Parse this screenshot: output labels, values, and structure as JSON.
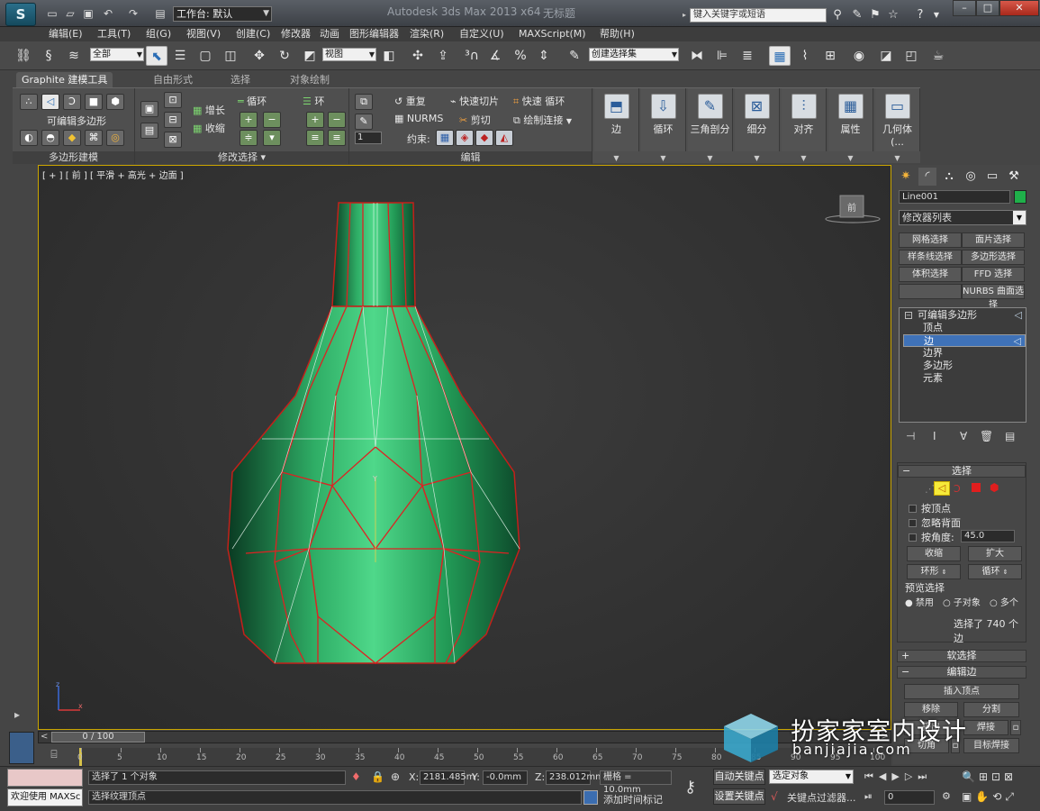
{
  "titlebar": {
    "app_title": "Autodesk 3ds Max  2013 x64",
    "doc_title": "无标题",
    "workspace_label": "工作台: 默认",
    "search_placeholder": "键入关键字或短语"
  },
  "menu": [
    "编辑(E)",
    "工具(T)",
    "组(G)",
    "视图(V)",
    "创建(C)",
    "修改器",
    "动画",
    "图形编辑器",
    "渲染(R)",
    "自定义(U)",
    "MAXScript(M)",
    "帮助(H)"
  ],
  "main_toolbar": {
    "filter_value": "全部",
    "refcoord_value": "视图",
    "named_selection_value": "创建选择集"
  },
  "ribbon": {
    "tabs": [
      "Graphite 建模工具",
      "自由形式",
      "选择",
      "对象绘制"
    ],
    "groups": {
      "polymodel": {
        "label": "多边形建模",
        "sub": "可编辑多边形"
      },
      "modsel": {
        "label": "修改选择",
        "grow": "增长",
        "shrink": "收缩",
        "loop": "循环",
        "ring": "环"
      },
      "edit": {
        "label": "编辑",
        "repeat": "重复",
        "quickslice": "快速切片",
        "quickloop": "快速 循环",
        "nurms": "NURMS",
        "cut": "剪切",
        "paintconnect": "绘制连接",
        "constraint": "约束:",
        "spin": "1"
      }
    },
    "big_buttons": [
      "边",
      "循环",
      "三角剖分",
      "细分",
      "对齐",
      "属性",
      "几何体 (..."
    ]
  },
  "viewport": {
    "label": "[ + ] [ 前 ] [ 平滑 + 高光 + 边面 ]",
    "viewcube_face": "前"
  },
  "command_panel": {
    "object_name": "Line001",
    "object_color": "#1fb04a",
    "modifier_list": "修改器列表",
    "mod_buttons": [
      "网格选择",
      "面片选择",
      "样条线选择",
      "多边形选择",
      "体积选择",
      "FFD 选择",
      "",
      "NURBS 曲面选择"
    ],
    "stack": [
      "可编辑多边形",
      "顶点",
      "边",
      "边界",
      "多边形",
      "元素"
    ],
    "rollout_select": {
      "title": "选择",
      "by_vertex": "按顶点",
      "ignore_back": "忽略背面",
      "by_angle": "按角度:",
      "angle_value": "45.0",
      "shrink": "收缩",
      "grow": "扩大",
      "ring": "环形",
      "loop": "循环",
      "preview_title": "预览选择",
      "preview_opts": [
        "禁用",
        "子对象",
        "多个"
      ],
      "status": "选择了 740 个边"
    },
    "rollout_soft": "软选择",
    "rollout_edit_edges": "编辑边",
    "insert_vertex": "插入顶点",
    "remove": "移除",
    "split": "分割",
    "extrude_partial": "挤出",
    "weld": "焊接",
    "chamfer": "切角",
    "target_weld": "目标焊接"
  },
  "timeline": {
    "slider_label": "0 / 100",
    "ticks": [
      "0",
      "5",
      "10",
      "15",
      "20",
      "25",
      "30",
      "35",
      "40",
      "45",
      "50",
      "55",
      "60",
      "65",
      "70",
      "75",
      "80",
      "85",
      "90",
      "95",
      "100"
    ]
  },
  "status": {
    "welcome": "欢迎使用 MAXSc",
    "selected": "选择了 1 个对象",
    "prompt": "选择纹理顶点",
    "x_label": "X:",
    "x_value": "2181.485m",
    "y_label": "Y:",
    "y_value": "-0.0mm",
    "z_label": "Z:",
    "z_value": "238.012mm",
    "grid": "栅格 = 10.0mm",
    "add_time_tag": "添加时间标记",
    "auto_key": "自动关键点",
    "set_key": "设置关键点",
    "selected_object": "选定对象",
    "key_filters": "关键点过滤器...",
    "frame": "0"
  },
  "watermark": {
    "brand": "扮家家室内设计",
    "url": "banjiajia.com"
  }
}
